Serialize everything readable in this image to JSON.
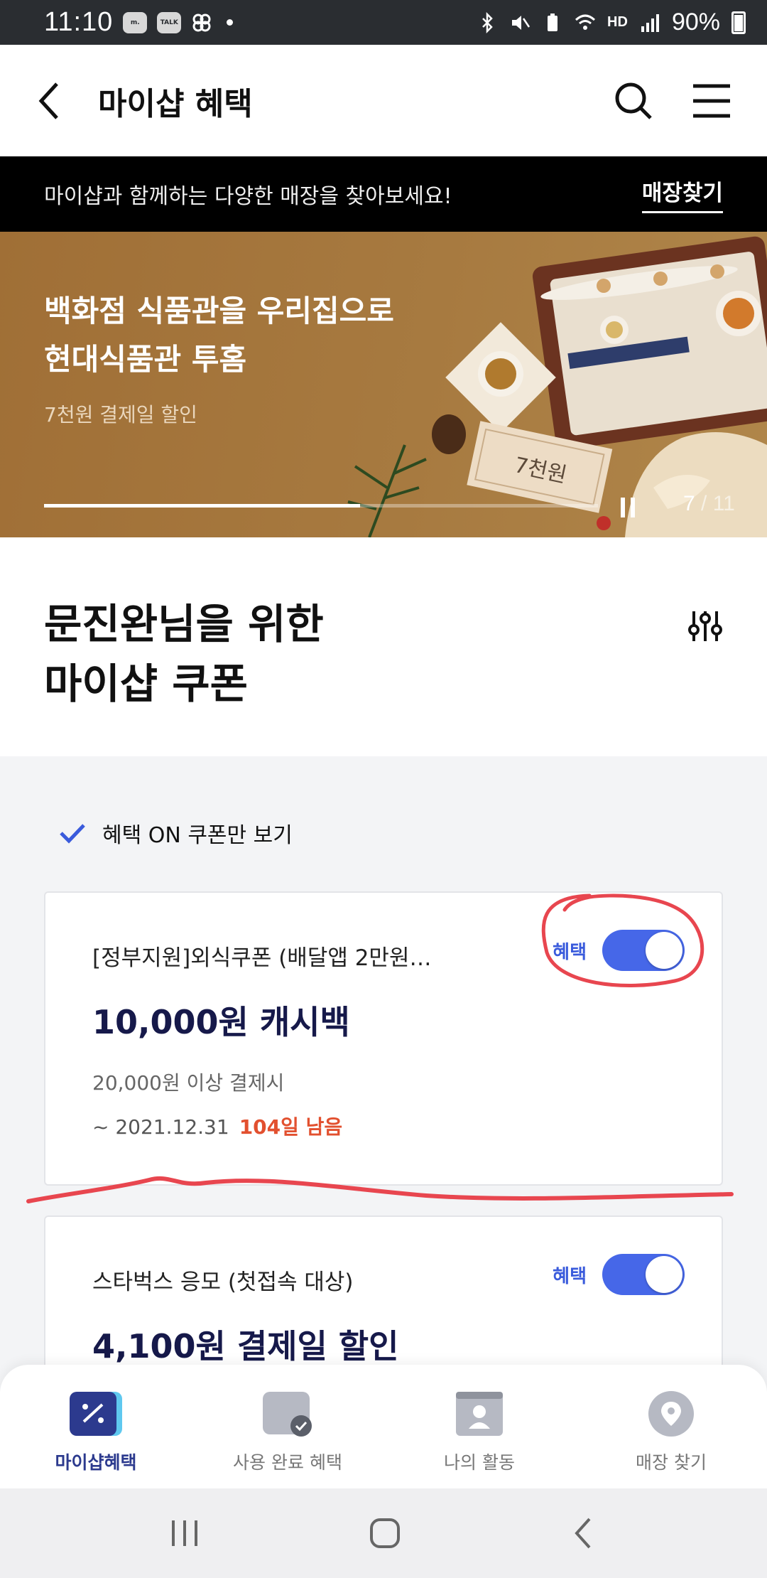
{
  "status_bar": {
    "time": "11:10",
    "app_icons": [
      "stock-icon",
      "kakaotalk-icon",
      "pinwheel-icon"
    ],
    "battery": "90%",
    "network": "HD"
  },
  "header": {
    "title": "마이샵 혜택"
  },
  "notice": {
    "message": "마이샵과 함께하는 다양한 매장을 찾아보세요!",
    "link": "매장찾기"
  },
  "banner": {
    "title_line1": "백화점 식품관을 우리집으로",
    "title_line2": "현대식품관 투홈",
    "subtitle": "7천원 결제일 할인",
    "tag_text": "7천원",
    "current": "7",
    "total": "/ 11",
    "progress_fraction": 0.57
  },
  "section": {
    "title_line1": "문진완님을 위한",
    "title_line2": "마이샵 쿠폰"
  },
  "filter": {
    "label": "혜택 ON 쿠폰만 보기",
    "checked": true
  },
  "coupons": [
    {
      "title": "[정부지원]외식쿠폰 (배달앱 2만원…",
      "amount": "10,000원 캐시백",
      "condition": "20,000원 이상 결제시",
      "expiry": "~ 2021.12.31",
      "days_left": "104일 남음",
      "toggle_label": "혜택",
      "toggle_on": true
    },
    {
      "title": "스타벅스 응모 (첫접속 대상)",
      "amount": "4,100원 결제일 할인",
      "toggle_label": "혜택",
      "toggle_on": true
    }
  ],
  "bottom_nav": [
    {
      "label": "마이샵혜택",
      "icon": "coupon-percent-icon",
      "active": true
    },
    {
      "label": "사용 완료 혜택",
      "icon": "used-coupon-icon",
      "active": false
    },
    {
      "label": "나의 활동",
      "icon": "profile-card-icon",
      "active": false
    },
    {
      "label": "매장 찾기",
      "icon": "location-pin-icon",
      "active": false
    }
  ],
  "colors": {
    "accent": "#4667e8",
    "navy": "#16194a",
    "highlight_red": "#e2502f",
    "annotation_red": "#e8464f"
  }
}
